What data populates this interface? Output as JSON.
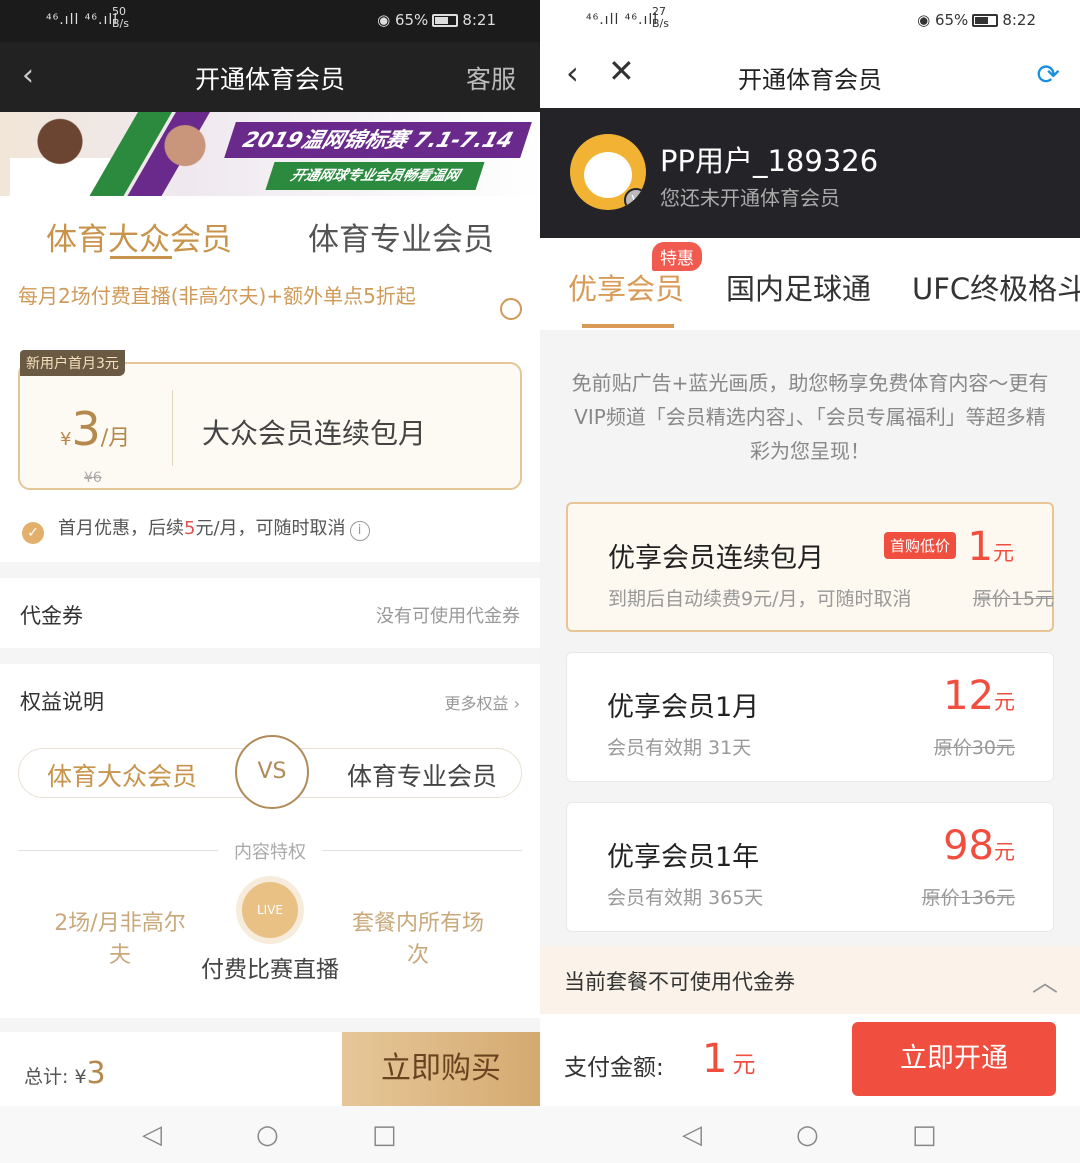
{
  "left": {
    "status": {
      "signal": "⁴⁶.ıll ⁴⁶.ıll",
      "speed_top": "50",
      "speed_unit": "B/s",
      "battery": "65%",
      "time": "8:21"
    },
    "nav": {
      "back": "‹",
      "title": "开通体育会员",
      "service": "客服"
    },
    "banner": {
      "line1": "2019温网锦标赛 7.1-7.14",
      "line2": "开通网球专业会员畅看温网"
    },
    "tabs": [
      "体育大众会员",
      "体育专业会员"
    ],
    "description": "每月2场付费直播(非高尔夫)+额外单点5折起",
    "plan": {
      "badge": "新用户首月3元",
      "currency": "¥",
      "price": "3",
      "unit": "/月",
      "original": "¥6",
      "name": "大众会员连续包月"
    },
    "note": {
      "check": "✓",
      "pre": "首月优惠，后续",
      "red": "5",
      "post": "元/月，可随时取消",
      "info": "i"
    },
    "coupon": {
      "label": "代金券",
      "value": "没有可使用代金券"
    },
    "benefits": {
      "title": "权益说明",
      "more": "更多权益 ›"
    },
    "compare": {
      "a": "体育大众会员",
      "vs": "VS",
      "b": "体育专业会员"
    },
    "privilege_title": "内容特权",
    "features": {
      "left": "2场/月非高尔夫",
      "center": "付费比赛直播",
      "live": "LIVE",
      "right": "套餐内所有场次"
    },
    "bottom": {
      "total_label": "总计: ¥",
      "total": "3",
      "buy": "立即购买"
    },
    "sysnav": [
      "◁",
      "○",
      "□"
    ]
  },
  "right": {
    "status": {
      "signal": "⁴⁶.ıll ⁴⁶.ıll",
      "speed_top": "27",
      "speed_unit": "B/s",
      "battery": "65%",
      "time": "8:22"
    },
    "nav": {
      "back": "‹",
      "close": "✕",
      "title": "开通体育会员",
      "refresh": "⟳"
    },
    "user": {
      "name": "PP用户_189326",
      "sub": "您还未开通体育会员",
      "badge": "V"
    },
    "tabs": [
      "优享会员",
      "国内足球通",
      "UFC终极格斗"
    ],
    "tab_tag": "特惠",
    "intro": "免前贴广告+蓝光画质，助您畅享免费体育内容～更有VIP频道「会员精选内容」、「会员专属福利」等超多精彩为您呈现！",
    "packages": [
      {
        "name": "优享会员连续包月",
        "sub": "到期后自动续费9元/月，可随时取消",
        "tag": "首购低价",
        "price": "1",
        "unit": "元",
        "original": "原价15元"
      },
      {
        "name": "优享会员1月",
        "sub": "会员有效期 31天",
        "price": "12",
        "unit": "元",
        "original": "原价30元"
      },
      {
        "name": "优享会员1年",
        "sub": "会员有效期 365天",
        "price": "98",
        "unit": "元",
        "original": "原价136元"
      }
    ],
    "coupon_notice": "当前套餐不可使用代金券",
    "pay": {
      "label": "支付金额:",
      "amount": "1",
      "unit": "元",
      "button": "立即开通"
    },
    "sysnav": [
      "◁",
      "○",
      "□"
    ]
  },
  "colors": {
    "gold": "#c8934b",
    "red": "#f04f40",
    "dark": "#242428"
  }
}
